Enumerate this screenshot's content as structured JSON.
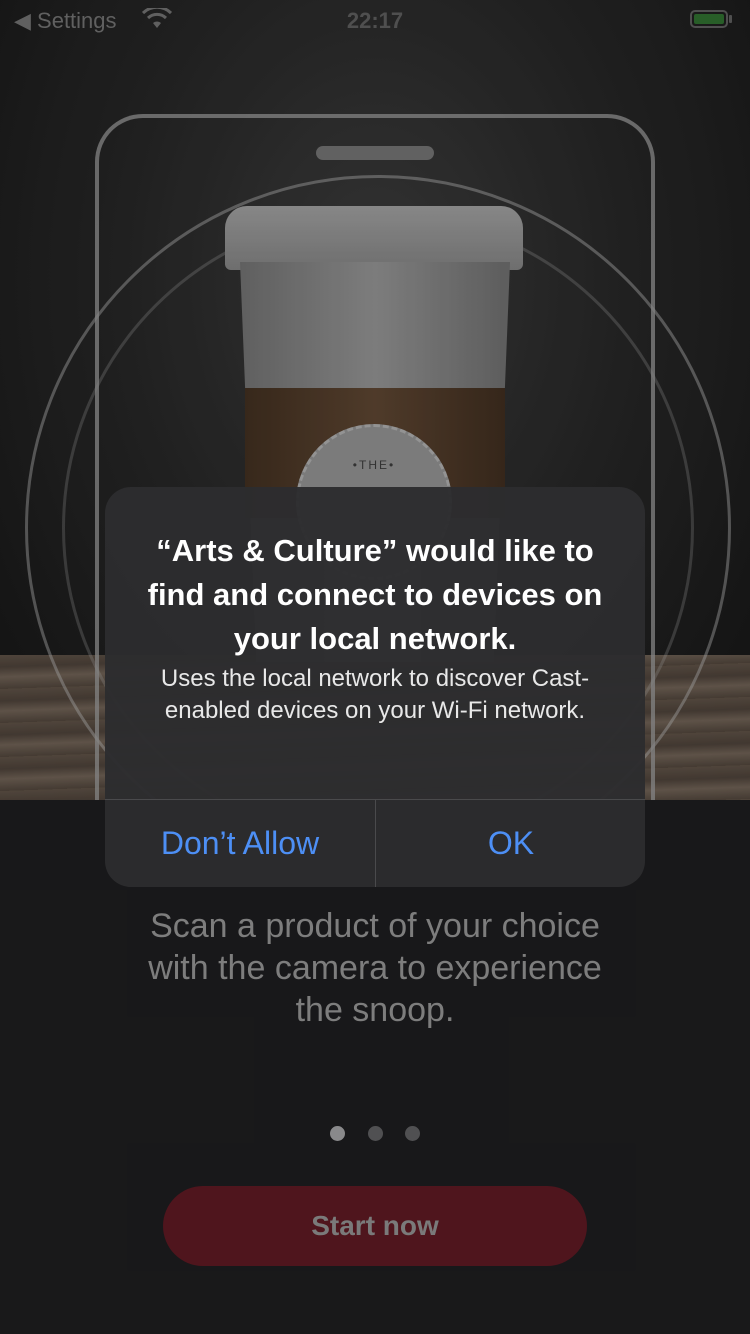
{
  "status_bar": {
    "back_label": "◀ Settings",
    "time": "22:17",
    "icons": [
      "wifi-icon",
      "battery-icon"
    ]
  },
  "hero": {
    "badge_text": "•THE•"
  },
  "onboarding": {
    "instruction": "Scan a product of your choice with the camera to experience the snoop.",
    "page_count": 3,
    "current_page": 1,
    "start_button": "Start now"
  },
  "alert": {
    "title": "“Arts & Culture” would like to find and connect to devices on your local network.",
    "message": "Uses the local network to discover Cast-enabled devices on your Wi-Fi network.",
    "deny_button": "Don’t Allow",
    "ok_button": "OK"
  },
  "colors": {
    "background": "#1c1c1e",
    "alert_background": "#2c2c2e",
    "alert_button": "#4d8ff5",
    "start_button": "#5b1821"
  }
}
